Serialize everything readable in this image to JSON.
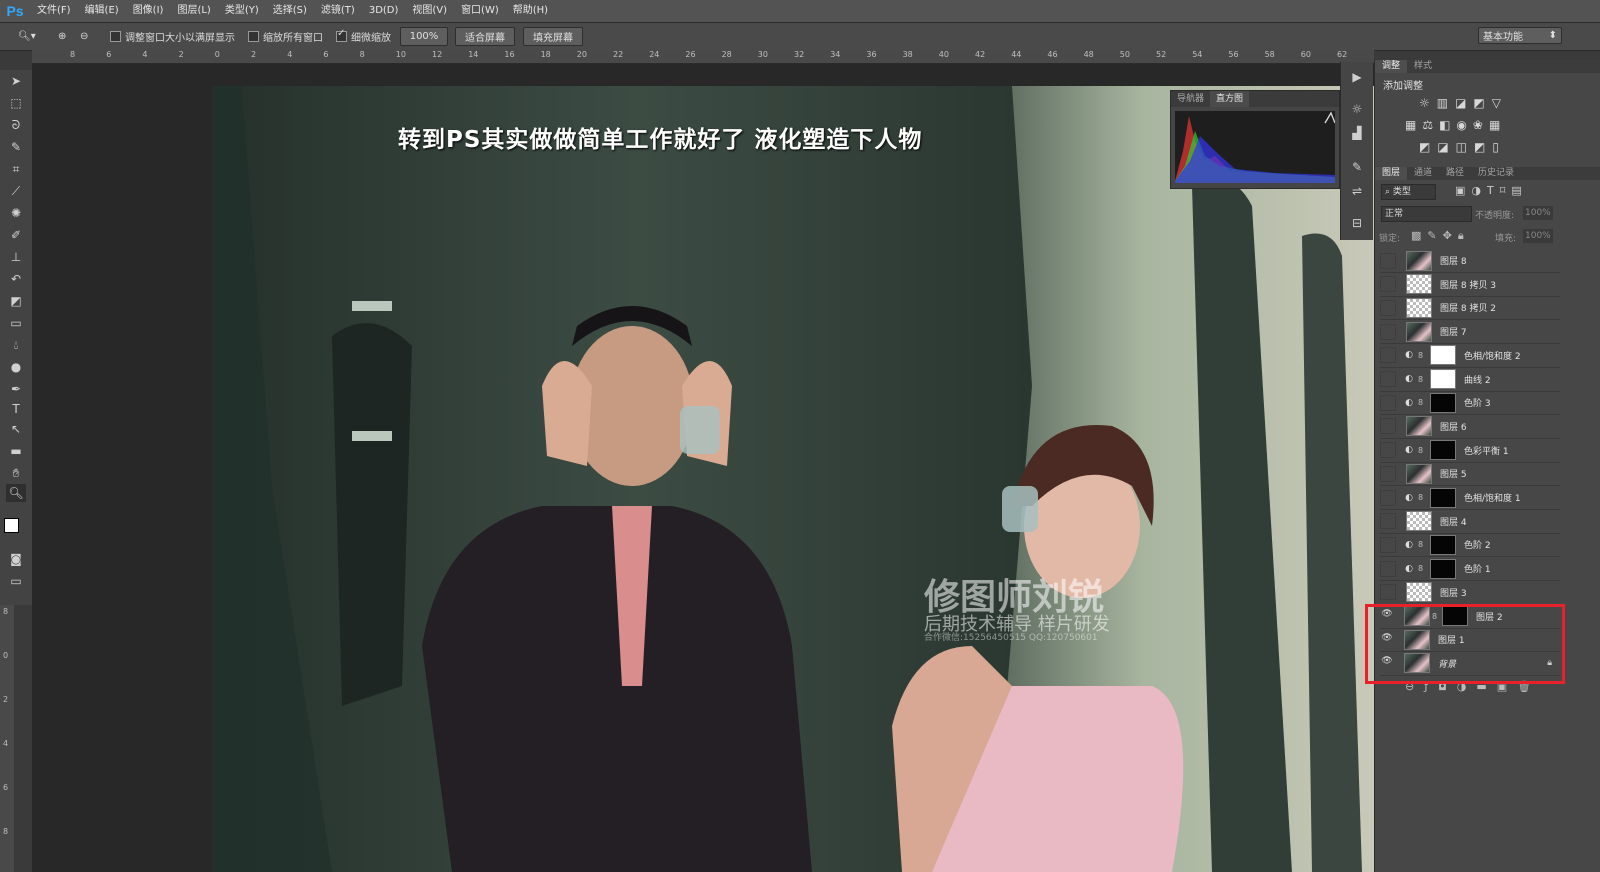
{
  "app_logo": "Ps",
  "menu": [
    "文件(F)",
    "编辑(E)",
    "图像(I)",
    "图层(L)",
    "类型(Y)",
    "选择(S)",
    "滤镜(T)",
    "3D(D)",
    "视图(V)",
    "窗口(W)",
    "帮助(H)"
  ],
  "options": {
    "resize_windows": "调整窗口大小以满屏显示",
    "zoom_all": "缩放所有窗口",
    "scrubby_zoom": "细微缩放",
    "zoom_level": "100%",
    "fit_screen": "适合屏幕",
    "fill_screen": "填充屏幕",
    "workspace": "基本功能"
  },
  "ruler_labels": [
    "8",
    "6",
    "4",
    "2",
    "0",
    "2",
    "4",
    "6",
    "8",
    "10",
    "12",
    "14",
    "16",
    "18",
    "20",
    "22",
    "24",
    "26",
    "28",
    "30",
    "32",
    "34",
    "36",
    "38",
    "40",
    "42",
    "44",
    "46",
    "48",
    "50",
    "52",
    "54",
    "56",
    "58",
    "60",
    "62"
  ],
  "vruler_labels": [
    "8",
    "0",
    "2",
    "4",
    "6",
    "8"
  ],
  "canvas": {
    "title": "转到PS其实做做简单工作就好了  液化塑造下人物",
    "watermark_main": "修图师刘锐",
    "watermark_sub": "后期技术辅导  样片研发",
    "watermark_contact": "合作微信:15256450515   QQ:120750601"
  },
  "histogram": {
    "tabs": [
      "导航器",
      "直方图"
    ]
  },
  "adjustments": {
    "tabs": [
      "调整",
      "样式"
    ],
    "heading": "添加调整"
  },
  "layers_panel": {
    "tabs": [
      "图层",
      "通道",
      "路径",
      "历史记录"
    ],
    "filter": "类型",
    "blend_mode": "正常",
    "opacity_label": "不透明度:",
    "opacity": "100%",
    "lock_label": "锁定:",
    "fill_label": "填充:",
    "fill": "100%",
    "layers": [
      {
        "name": "图层 8",
        "thumb": "photo",
        "visible": false
      },
      {
        "name": "图层 8 拷贝 3",
        "thumb": "trans",
        "visible": false
      },
      {
        "name": "图层 8 拷贝 2",
        "thumb": "trans",
        "visible": false
      },
      {
        "name": "图层 7",
        "thumb": "photo",
        "visible": false
      },
      {
        "name": "色相/饱和度 2",
        "thumb": "white",
        "visible": false,
        "adjust": true
      },
      {
        "name": "曲线 2",
        "thumb": "white",
        "visible": false,
        "adjust": true
      },
      {
        "name": "色阶 3",
        "thumb": "black",
        "visible": false,
        "adjust": true
      },
      {
        "name": "图层 6",
        "thumb": "photo",
        "visible": false
      },
      {
        "name": "色彩平衡 1",
        "thumb": "black",
        "visible": false,
        "adjust": true
      },
      {
        "name": "图层 5",
        "thumb": "photo",
        "visible": false
      },
      {
        "name": "色相/饱和度 1",
        "thumb": "black",
        "visible": false,
        "adjust": true
      },
      {
        "name": "图层 4",
        "thumb": "trans",
        "visible": false
      },
      {
        "name": "色阶 2",
        "thumb": "black",
        "visible": false,
        "adjust": true
      },
      {
        "name": "色阶 1",
        "thumb": "black",
        "visible": false,
        "adjust": true
      },
      {
        "name": "图层 3",
        "thumb": "trans",
        "visible": false
      },
      {
        "name": "图层 2",
        "thumb": "photo",
        "visible": true,
        "mask": true
      },
      {
        "name": "图层 1",
        "thumb": "photo",
        "visible": true
      },
      {
        "name": "背景",
        "thumb": "photo",
        "visible": true,
        "locked": true
      }
    ]
  },
  "colors": {
    "highlight": "#e8212b",
    "accent": "#31a8ff"
  }
}
